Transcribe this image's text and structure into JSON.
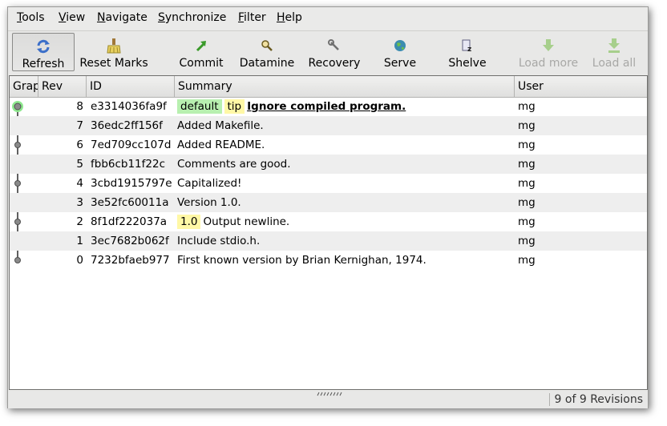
{
  "menu": [
    {
      "mnemonic": "T",
      "rest": "ools"
    },
    {
      "mnemonic": "V",
      "rest": "iew"
    },
    {
      "mnemonic": "N",
      "rest": "avigate"
    },
    {
      "mnemonic": "S",
      "rest": "ynchronize"
    },
    {
      "mnemonic": "F",
      "rest": "ilter"
    },
    {
      "mnemonic": "H",
      "rest": "elp"
    }
  ],
  "toolbar": {
    "refresh": "Refresh",
    "reset_marks": "Reset Marks",
    "commit": "Commit",
    "datamine": "Datamine",
    "recovery": "Recovery",
    "serve": "Serve",
    "shelve": "Shelve",
    "load_more": "Load more",
    "load_all": "Load all"
  },
  "columns": {
    "graph": "Graph",
    "rev": "Rev",
    "id": "ID",
    "summary": "Summary",
    "user": "User"
  },
  "rows": [
    {
      "rev": "8",
      "id": "e3314036fa9f",
      "tags": {
        "default": "default",
        "tip": "tip"
      },
      "summary": "Ignore compiled program.",
      "user": "mg"
    },
    {
      "rev": "7",
      "id": "36edc2ff156f",
      "summary": "Added Makefile.",
      "user": "mg"
    },
    {
      "rev": "6",
      "id": "7ed709cc107d",
      "summary": "Added README.",
      "user": "mg"
    },
    {
      "rev": "5",
      "id": "fbb6cb11f22c",
      "summary": "Comments are good.",
      "user": "mg"
    },
    {
      "rev": "4",
      "id": "3cbd1915797e",
      "summary": "Capitalized!",
      "user": "mg"
    },
    {
      "rev": "3",
      "id": "3e52fc60011a",
      "summary": "Version 1.0.",
      "user": "mg"
    },
    {
      "rev": "2",
      "id": "8f1df222037a",
      "tags": {
        "version": "1.0"
      },
      "summary": "Output newline.",
      "user": "mg"
    },
    {
      "rev": "1",
      "id": "3ec7682b062f",
      "summary": "Include stdio.h.",
      "user": "mg"
    },
    {
      "rev": "0",
      "id": "7232bfaeb977",
      "summary": "First known version by Brian Kernighan, 1974.",
      "user": "mg"
    }
  ],
  "status": "9 of 9 Revisions",
  "colors": {
    "tag_default": "#b8f0b0",
    "tag_tip": "#fff8a6",
    "working_node": "#8ee88e"
  }
}
